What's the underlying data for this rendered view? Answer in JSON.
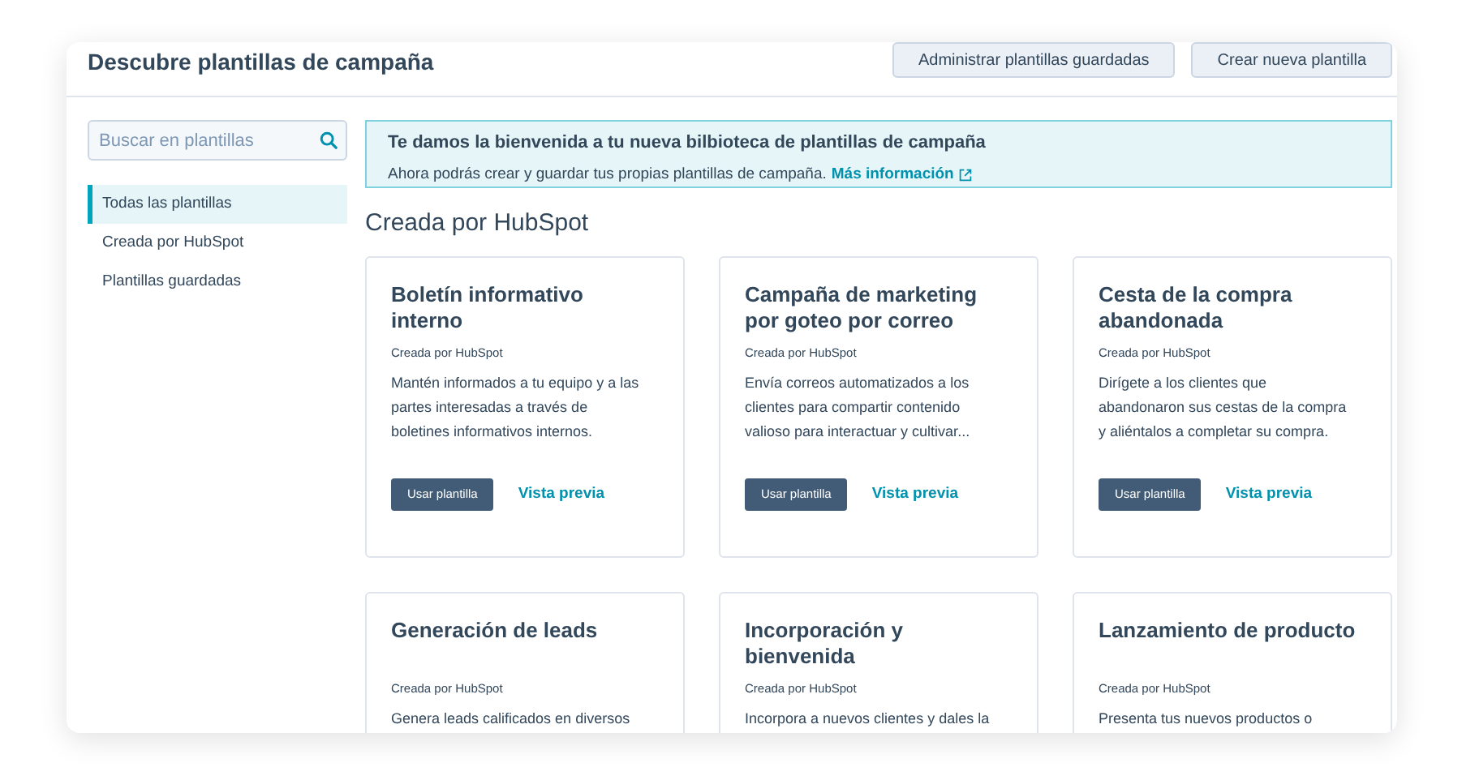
{
  "header": {
    "title": "Descubre plantillas de campaña",
    "buttons": [
      "Administrar plantillas guardadas",
      "Crear nueva plantilla"
    ]
  },
  "sidebar": {
    "search": {
      "placeholder": "Buscar en plantillas"
    },
    "items": [
      {
        "label": "Todas las plantillas",
        "selected": true
      },
      {
        "label": "Creada por HubSpot",
        "selected": false
      },
      {
        "label": "Plantillas guardadas",
        "selected": false
      }
    ]
  },
  "banner": {
    "title": "Te damos la bienvenida a tu nueva bilbioteca de plantillas de campaña",
    "text": "Ahora podrás crear y guardar tus propias plantillas de campaña.",
    "link": "Más información"
  },
  "section_title": "Creada por HubSpot",
  "cards": [
    {
      "title": "Boletín informativo interno",
      "source": "Creada por HubSpot",
      "description": "Mantén informados a tu equipo y a las partes interesadas a través de boletines informativos internos.",
      "primary": "Usar plantilla",
      "secondary": "Vista previa"
    },
    {
      "title": "Campaña de marketing por goteo por correo",
      "source": "Creada por HubSpot",
      "description": "Envía correos automatizados a los clientes para compartir contenido valioso para interactuar y cultivar...",
      "primary": "Usar plantilla",
      "secondary": "Vista previa"
    },
    {
      "title": "Cesta de la compra abandonada",
      "source": "Creada por HubSpot",
      "description": "Dirígete a los clientes que abandonaron sus cestas de la compra y aliéntalos a completar su compra.",
      "primary": "Usar plantilla",
      "secondary": "Vista previa"
    },
    {
      "title": "Generación de leads",
      "source": "Creada por HubSpot",
      "description": "Genera leads calificados en diversos"
    },
    {
      "title": "Incorporación y bienvenida",
      "source": "Creada por HubSpot",
      "description": "Incorpora a nuevos clientes y dales la"
    },
    {
      "title": "Lanzamiento de producto",
      "source": "Creada por HubSpot",
      "description": "Presenta tus nuevos productos o"
    }
  ]
}
